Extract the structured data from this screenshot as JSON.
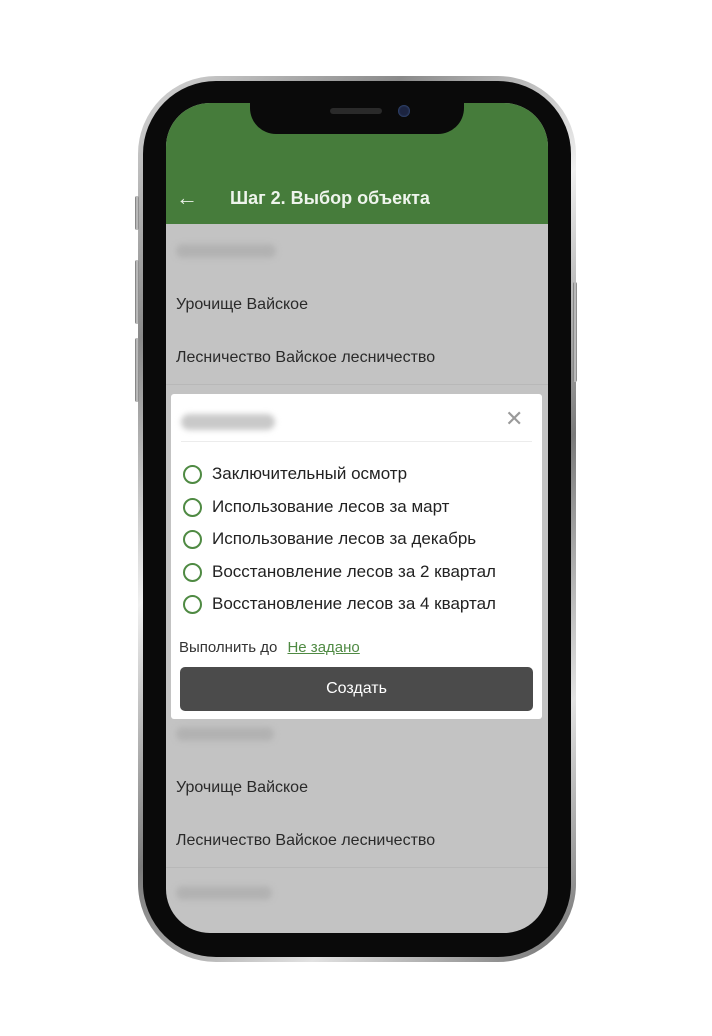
{
  "header": {
    "title": "Шаг 2. Выбор объекта",
    "back_icon": "arrow-left-icon"
  },
  "colors": {
    "appbar": "#467c3b",
    "accent": "#4f8a43",
    "button": "#4b4b4b",
    "overlay": "#c3c3c3"
  },
  "list": {
    "items": [
      {
        "tract": "Урочище Вайское",
        "forestry": "Лесничество Вайское лесничество"
      },
      {
        "tract": "Урочище Вайское",
        "forestry": "Лесничество Вайское лесничество"
      }
    ]
  },
  "dialog": {
    "options": [
      "Заключительный осмотр",
      "Использование лесов за март",
      "Использование лесов за декабрь",
      "Восстановление лесов за 2 квартал",
      "Восстановление лесов за 4 квартал"
    ],
    "close_icon": "close-icon",
    "due_label": "Выполнить до",
    "due_value": "Не задано",
    "create_label": "Создать"
  }
}
